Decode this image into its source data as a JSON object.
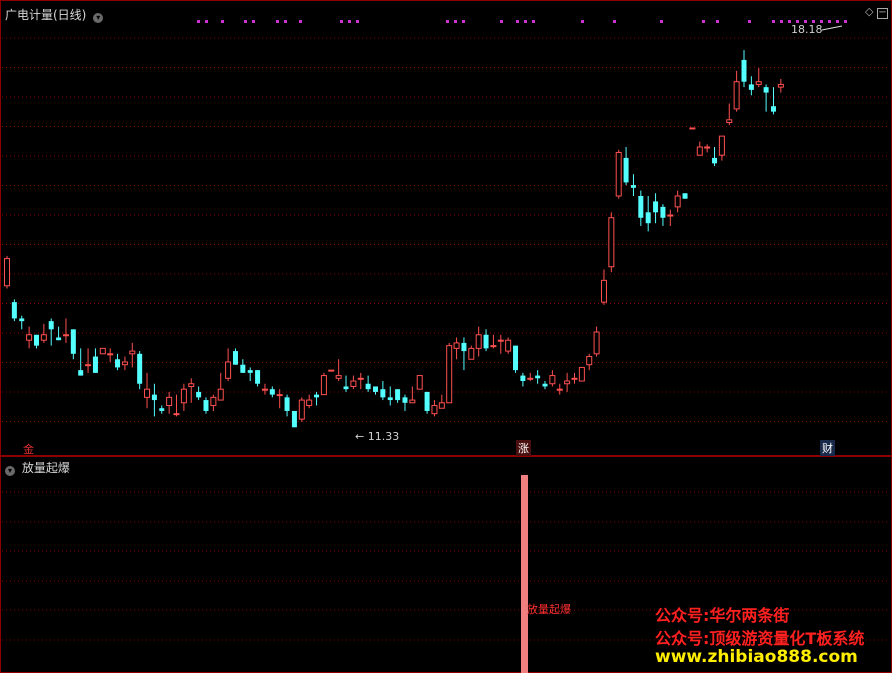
{
  "upper_panel": {
    "title": "广电计量(日线)",
    "high_label": "18.18",
    "low_label": "11.33",
    "markers": [
      {
        "text": "金",
        "color": "#e03030"
      },
      {
        "text": "涨",
        "color": "#ffffff"
      },
      {
        "text": "财",
        "color": "#ffffff"
      }
    ]
  },
  "lower_panel": {
    "title": "放量起爆",
    "signal_label": "放量起爆"
  },
  "watermarks": {
    "line1": "公众号:华尔两条街",
    "line2": "公众号:顶级游资量化T板系统",
    "line3": "www.zhibiao888.com"
  },
  "colors": {
    "up": "#ff5050",
    "down": "#54ffff",
    "grid": "#8b0000",
    "signal_bar": "#f08080",
    "dots": "#cc33cc",
    "watermark1": "#ff2020",
    "watermark2": "#ffee00"
  },
  "chart_data": {
    "type": "candlestick",
    "price_high": 18.18,
    "price_low": 11.33,
    "candles": [
      [
        13.85,
        14.35,
        14.4,
        13.8
      ],
      [
        13.55,
        13.25,
        13.6,
        13.2
      ],
      [
        13.25,
        13.2,
        13.3,
        13.05
      ],
      [
        12.85,
        12.95,
        13.1,
        12.7
      ],
      [
        12.95,
        12.75,
        12.95,
        12.7
      ],
      [
        12.85,
        12.95,
        13.15,
        12.8
      ],
      [
        13.2,
        13.05,
        13.25,
        12.75
      ],
      [
        12.9,
        12.85,
        13.1,
        12.85
      ],
      [
        12.95,
        12.95,
        13.25,
        12.8
      ],
      [
        13.05,
        12.6,
        13.05,
        12.5
      ],
      [
        12.3,
        12.2,
        12.7,
        12.2
      ],
      [
        12.4,
        12.4,
        12.7,
        12.25
      ],
      [
        12.55,
        12.25,
        12.7,
        12.25
      ],
      [
        12.6,
        12.7,
        12.7,
        12.6
      ],
      [
        12.6,
        12.6,
        12.7,
        12.45
      ],
      [
        12.5,
        12.35,
        12.6,
        12.3
      ],
      [
        12.4,
        12.45,
        12.55,
        12.3
      ],
      [
        12.6,
        12.65,
        12.8,
        12.35
      ],
      [
        12.6,
        12.05,
        12.65,
        11.95
      ],
      [
        11.8,
        11.95,
        12.25,
        11.6
      ],
      [
        11.85,
        11.75,
        12.05,
        11.45
      ],
      [
        11.6,
        11.55,
        11.65,
        11.5
      ],
      [
        11.65,
        11.8,
        11.9,
        11.5
      ],
      [
        11.5,
        11.5,
        11.85,
        11.45
      ],
      [
        11.7,
        11.95,
        12.05,
        11.55
      ],
      [
        12.0,
        12.05,
        12.15,
        11.7
      ],
      [
        11.9,
        11.8,
        12.0,
        11.75
      ],
      [
        11.75,
        11.55,
        11.8,
        11.5
      ],
      [
        11.65,
        11.8,
        11.85,
        11.55
      ],
      [
        11.75,
        11.95,
        12.25,
        11.75
      ],
      [
        12.15,
        12.45,
        12.7,
        12.1
      ],
      [
        12.65,
        12.4,
        12.7,
        12.4
      ],
      [
        12.4,
        12.25,
        12.5,
        12.25
      ],
      [
        12.3,
        12.25,
        12.35,
        12.1
      ],
      [
        12.3,
        12.05,
        12.3,
        12.0
      ],
      [
        11.95,
        11.95,
        12.05,
        11.85
      ],
      [
        11.95,
        11.85,
        12.0,
        11.8
      ],
      [
        11.85,
        11.85,
        11.95,
        11.6
      ],
      [
        11.8,
        11.55,
        11.85,
        11.45
      ],
      [
        11.55,
        11.25,
        11.55,
        11.25
      ],
      [
        11.4,
        11.75,
        11.8,
        11.35
      ],
      [
        11.65,
        11.75,
        11.85,
        11.6
      ],
      [
        11.85,
        11.8,
        11.9,
        11.65
      ],
      [
        11.85,
        12.2,
        12.25,
        11.85
      ],
      [
        12.3,
        12.3,
        12.3,
        12.3
      ],
      [
        12.15,
        12.2,
        12.5,
        12.1
      ],
      [
        12.0,
        11.95,
        12.2,
        11.9
      ],
      [
        12.0,
        12.1,
        12.2,
        11.95
      ],
      [
        12.15,
        12.15,
        12.25,
        11.95
      ],
      [
        12.05,
        11.95,
        12.2,
        11.9
      ],
      [
        12.0,
        11.9,
        12.0,
        11.85
      ],
      [
        11.95,
        11.8,
        12.1,
        11.75
      ],
      [
        11.8,
        11.75,
        12.0,
        11.65
      ],
      [
        11.95,
        11.75,
        11.95,
        11.7
      ],
      [
        11.8,
        11.7,
        11.85,
        11.55
      ],
      [
        11.7,
        11.75,
        12.0,
        11.7
      ],
      [
        11.95,
        12.2,
        12.2,
        11.95
      ],
      [
        11.9,
        11.55,
        11.9,
        11.5
      ],
      [
        11.5,
        11.65,
        11.75,
        11.45
      ],
      [
        11.6,
        11.7,
        11.85,
        11.6
      ],
      [
        11.7,
        12.75,
        12.8,
        11.7
      ],
      [
        12.7,
        12.8,
        12.9,
        12.5
      ],
      [
        12.8,
        12.65,
        12.9,
        12.3
      ],
      [
        12.5,
        12.7,
        12.75,
        12.5
      ],
      [
        12.7,
        12.95,
        13.1,
        12.55
      ],
      [
        12.95,
        12.7,
        13.05,
        12.65
      ],
      [
        12.75,
        12.75,
        12.95,
        12.7
      ],
      [
        12.85,
        12.85,
        12.95,
        12.6
      ],
      [
        12.65,
        12.85,
        12.9,
        12.6
      ],
      [
        12.75,
        12.3,
        12.75,
        12.25
      ],
      [
        12.2,
        12.1,
        12.25,
        12.0
      ],
      [
        12.15,
        12.15,
        12.25,
        12.1
      ],
      [
        12.2,
        12.15,
        12.3,
        12.05
      ],
      [
        12.05,
        12.0,
        12.1,
        11.95
      ],
      [
        12.05,
        12.2,
        12.3,
        12.0
      ],
      [
        11.95,
        11.95,
        12.05,
        11.85
      ],
      [
        12.05,
        12.1,
        12.25,
        11.9
      ],
      [
        12.15,
        12.15,
        12.25,
        12.05
      ],
      [
        12.1,
        12.35,
        12.35,
        12.1
      ],
      [
        12.4,
        12.55,
        12.6,
        12.3
      ],
      [
        12.6,
        13.0,
        13.1,
        12.55
      ],
      [
        13.55,
        13.95,
        14.15,
        13.5
      ],
      [
        14.2,
        15.1,
        15.2,
        14.1
      ],
      [
        15.5,
        16.3,
        16.35,
        15.45
      ],
      [
        16.2,
        15.75,
        16.4,
        15.7
      ],
      [
        15.7,
        15.65,
        15.9,
        15.5
      ],
      [
        15.5,
        15.1,
        15.6,
        14.95
      ],
      [
        15.2,
        15.0,
        15.5,
        14.85
      ],
      [
        15.4,
        15.2,
        15.55,
        15.0
      ],
      [
        15.3,
        15.1,
        15.35,
        14.95
      ],
      [
        15.15,
        15.15,
        15.25,
        14.95
      ],
      [
        15.3,
        15.5,
        15.6,
        15.2
      ],
      [
        15.55,
        15.45,
        15.55,
        15.45
      ],
      [
        16.75,
        16.75,
        16.75,
        16.75
      ],
      [
        16.25,
        16.4,
        16.5,
        16.25
      ],
      [
        16.4,
        16.4,
        16.45,
        16.3
      ],
      [
        16.2,
        16.1,
        16.4,
        16.05
      ],
      [
        16.25,
        16.6,
        16.6,
        16.15
      ],
      [
        16.85,
        16.9,
        17.2,
        16.8
      ],
      [
        17.1,
        17.6,
        17.8,
        17.05
      ],
      [
        18.0,
        17.6,
        18.18,
        17.5
      ],
      [
        17.55,
        17.45,
        17.7,
        17.35
      ],
      [
        17.55,
        17.6,
        17.85,
        17.5
      ],
      [
        17.5,
        17.4,
        17.55,
        17.05
      ],
      [
        17.15,
        17.05,
        17.5,
        17.0
      ],
      [
        17.5,
        17.55,
        17.65,
        17.4
      ]
    ]
  }
}
